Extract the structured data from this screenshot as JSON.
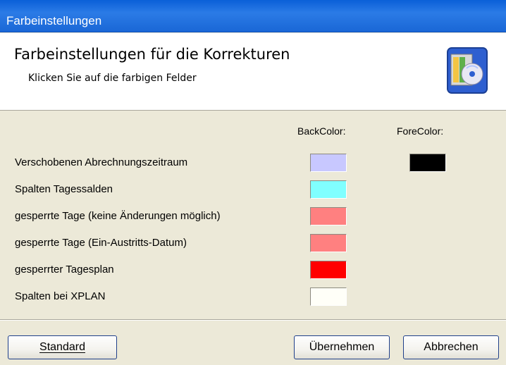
{
  "window": {
    "title": "Farbeinstellungen"
  },
  "header": {
    "heading": "Farbeinstellungen für die Korrekturen",
    "subheading": "Klicken Sie auf die farbigen Felder",
    "icon": "application-cd-icon"
  },
  "columns": {
    "back": "BackColor:",
    "fore": "ForeColor:"
  },
  "rows": [
    {
      "label": "Verschobenen Abrechnungszeitraum",
      "back_color": "#c8c8ff",
      "fore_color": "#000000"
    },
    {
      "label": "Spalten Tagessalden",
      "back_color": "#80ffff"
    },
    {
      "label": "gesperrte Tage (keine Änderungen möglich)",
      "back_color": "#ff8080"
    },
    {
      "label": "gesperrte Tage (Ein-Austritts-Datum)",
      "back_color": "#ff8080"
    },
    {
      "label": "gesperrter Tagesplan",
      "back_color": "#ff0000"
    },
    {
      "label": "Spalten bei XPLAN",
      "back_color": "#fffff8"
    }
  ],
  "buttons": {
    "standard_label": "Standard",
    "apply_label": "Übernehmen",
    "cancel_label": "Abbrechen"
  }
}
